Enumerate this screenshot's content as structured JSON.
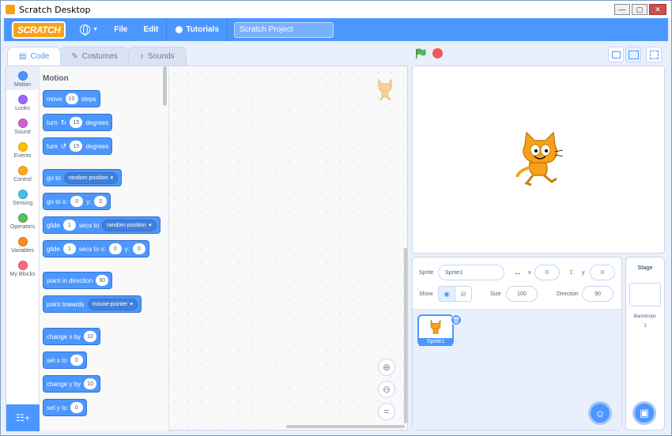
{
  "window": {
    "title": "Scratch Desktop",
    "buttons": [
      "—",
      "▢",
      "✕"
    ]
  },
  "menubar": {
    "logo": "SCRATCH",
    "file": "File",
    "edit": "Edit",
    "tutorials": "Tutorials",
    "project_title": "Scratch Project"
  },
  "tabs": [
    {
      "label": "Code",
      "icon": "code-icon"
    },
    {
      "label": "Costumes",
      "icon": "brush-icon"
    },
    {
      "label": "Sounds",
      "icon": "speaker-icon"
    }
  ],
  "categories": [
    {
      "label": "Motion",
      "color": "#4c97ff"
    },
    {
      "label": "Looks",
      "color": "#9966ff"
    },
    {
      "label": "Sound",
      "color": "#cf63cf"
    },
    {
      "label": "Events",
      "color": "#ffbf00"
    },
    {
      "label": "Control",
      "color": "#ffab19"
    },
    {
      "label": "Sensing",
      "color": "#4cbfe6"
    },
    {
      "label": "Operators",
      "color": "#59c059"
    },
    {
      "label": "Variables",
      "color": "#ff8c1a"
    },
    {
      "label": "My Blocks",
      "color": "#ff6680"
    }
  ],
  "palette": {
    "heading": "Motion",
    "blocks": {
      "move": {
        "a": "move",
        "n": "10",
        "b": "steps"
      },
      "turn_cw": {
        "a": "turn",
        "n": "15",
        "b": "degrees"
      },
      "turn_ccw": {
        "a": "turn",
        "n": "15",
        "b": "degrees"
      },
      "goto": {
        "a": "go to",
        "d": "random position"
      },
      "gotoxy": {
        "a": "go to x:",
        "x": "0",
        "b": "y:",
        "y": "0"
      },
      "glide": {
        "a": "glide",
        "n": "1",
        "b": "secs to",
        "d": "random position"
      },
      "glidexy": {
        "a": "glide",
        "n": "1",
        "b": "secs to x:",
        "x": "0",
        "c": "y:",
        "y": "0"
      },
      "point_dir": {
        "a": "point in direction",
        "n": "90"
      },
      "point_towards": {
        "a": "point towards",
        "d": "mouse-pointer"
      },
      "change_x": {
        "a": "change x by",
        "n": "10"
      },
      "set_x": {
        "a": "set x to",
        "n": "0"
      },
      "change_y": {
        "a": "change y by",
        "n": "10"
      },
      "set_y": {
        "a": "set y to",
        "n": "0"
      }
    }
  },
  "sprite_info": {
    "sprite_label": "Sprite",
    "sprite_name": "Sprite1",
    "x_label": "x",
    "x_value": "0",
    "y_label": "y",
    "y_value": "0",
    "show_label": "Show",
    "size_label": "Size",
    "size_value": "100",
    "direction_label": "Direction",
    "direction_value": "90"
  },
  "sprites": [
    {
      "name": "Sprite1"
    }
  ],
  "stage_pane": {
    "title": "Stage",
    "backdrops_label": "Backdrops",
    "backdrops_count": "1"
  }
}
